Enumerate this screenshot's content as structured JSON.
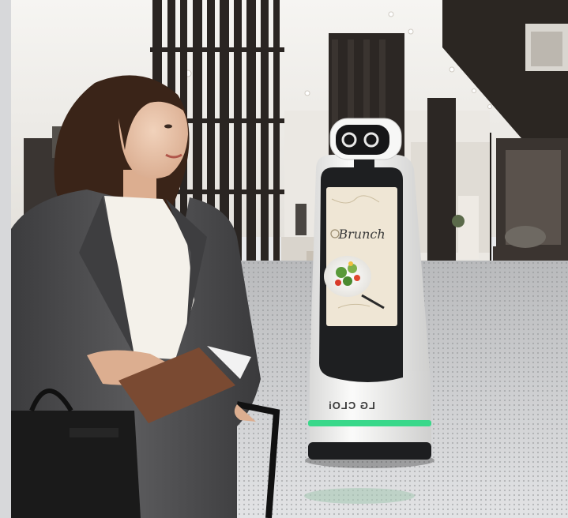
{
  "photo": {
    "robot": {
      "brand_label": "LG CLOi",
      "screen_title": "Brunch"
    },
    "colors": {
      "floor": "#cfd0d2",
      "ceiling": "#f3f2ef",
      "wall_dark": "#24211f",
      "robot_body": "#f5f5f4",
      "robot_panel": "#1e1f21",
      "screen_paper": "#efe6d5",
      "accent_green": "#39d88a",
      "jacket": "#4a4a4c",
      "shirt": "#f4f1ea",
      "wallet": "#7a4a32",
      "bag": "#1a1a1a"
    }
  }
}
